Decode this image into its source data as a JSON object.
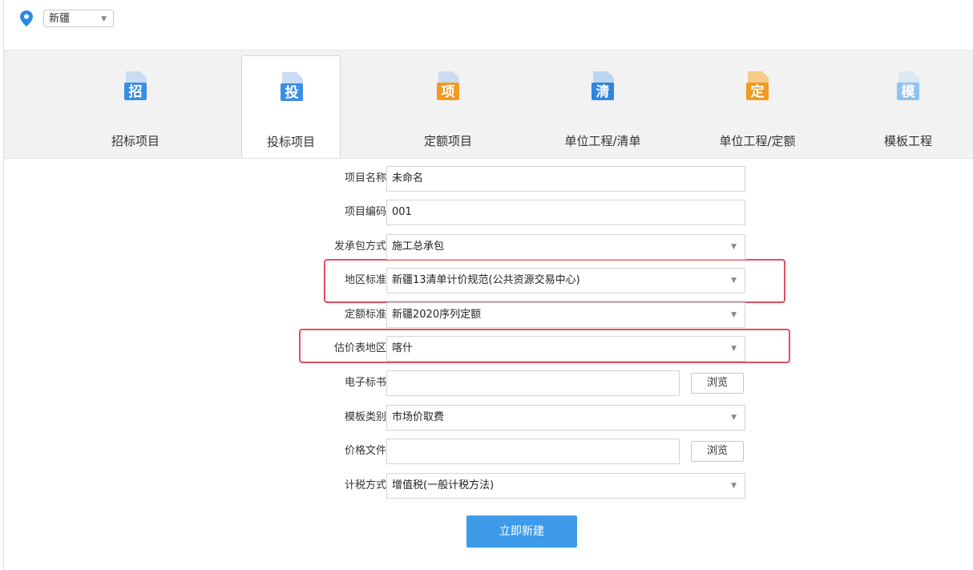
{
  "region": {
    "selected": "新疆"
  },
  "tabs": [
    {
      "label": "招标项目",
      "glyph": "招",
      "color": "#3a8ee6",
      "doc": "#c9dcf3",
      "active": false
    },
    {
      "label": "投标项目",
      "glyph": "投",
      "color": "#3a8ee6",
      "doc": "#c9dcf3",
      "active": true
    },
    {
      "label": "定额项目",
      "glyph": "项",
      "color": "#f29a22",
      "doc": "#c9dcf3",
      "active": false
    },
    {
      "label": "单位工程/清单",
      "glyph": "清",
      "color": "#2f86e0",
      "doc": "#bcd6f2",
      "active": false
    },
    {
      "label": "单位工程/定额",
      "glyph": "定",
      "color": "#f29a22",
      "doc": "#f7c98a",
      "active": false
    },
    {
      "label": "模板工程",
      "glyph": "模",
      "color": "#8fc3ef",
      "doc": "#dde8f3",
      "active": false
    }
  ],
  "form": {
    "project_name": {
      "label": "项目名称",
      "value": "未命名"
    },
    "project_code": {
      "label": "项目编码",
      "value": "001"
    },
    "contract_mode": {
      "label": "发承包方式",
      "value": "施工总承包"
    },
    "region_standard": {
      "label": "地区标准",
      "value": "新疆13清单计价规范(公共资源交易中心)"
    },
    "quota_standard": {
      "label": "定额标准",
      "value": "新疆2020序列定额"
    },
    "valuation_region": {
      "label": "估价表地区",
      "value": "喀什"
    },
    "e_tender": {
      "label": "电子标书",
      "value": "",
      "browse": "浏览"
    },
    "template_type": {
      "label": "模板类别",
      "value": "市场价取费"
    },
    "price_file": {
      "label": "价格文件",
      "value": "",
      "browse": "浏览"
    },
    "tax_method": {
      "label": "计税方式",
      "value": "增值税(一般计税方法)"
    }
  },
  "create_button": "立即新建",
  "colors": {
    "accent": "#3d9be9",
    "highlight": "#e05060"
  }
}
